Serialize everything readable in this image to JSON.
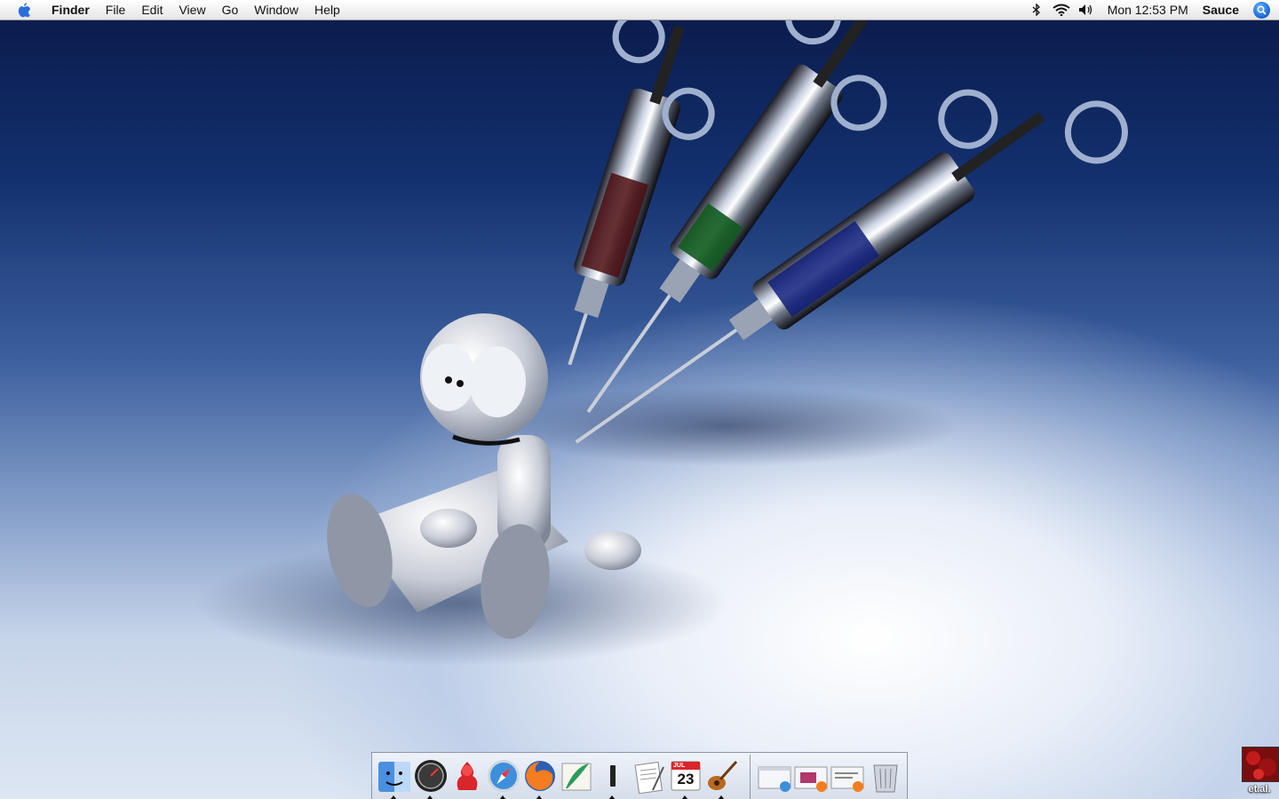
{
  "menubar": {
    "app_name": "Finder",
    "menus": [
      "File",
      "Edit",
      "View",
      "Go",
      "Window",
      "Help"
    ],
    "clock": "Mon 12:53 PM",
    "user": "Sauce",
    "status_icons": [
      "bluetooth-icon",
      "wifi-icon",
      "volume-icon"
    ]
  },
  "dock": {
    "apps": [
      {
        "name": "Finder",
        "icon": "finder-icon",
        "running": true
      },
      {
        "name": "Dashboard",
        "icon": "dashboard-icon",
        "running": true
      },
      {
        "name": "Fire",
        "icon": "fire-chat-icon",
        "running": false
      },
      {
        "name": "Safari",
        "icon": "safari-icon",
        "running": true
      },
      {
        "name": "Firefox",
        "icon": "firefox-icon",
        "running": true
      },
      {
        "name": "Quill",
        "icon": "quill-icon",
        "running": false
      },
      {
        "name": "Terminal",
        "icon": "terminal-icon",
        "running": true
      },
      {
        "name": "TextEdit",
        "icon": "textedit-icon",
        "running": false
      },
      {
        "name": "iCal",
        "icon": "ical-icon",
        "running": true
      },
      {
        "name": "GarageBand",
        "icon": "garageband-icon",
        "running": true
      }
    ],
    "calendar": {
      "month": "JUL",
      "day": "23"
    },
    "minimized": [
      {
        "icon": "minimized-safari-window-icon"
      },
      {
        "icon": "minimized-firefox-window-1-icon"
      },
      {
        "icon": "minimized-firefox-window-2-icon"
      }
    ],
    "trash": {
      "icon": "trash-icon"
    }
  },
  "desktop_item": {
    "label": "et.al."
  },
  "colors": {
    "menubar_bg": "#f2f2f2",
    "wallpaper_dark": "#0a1a4a",
    "wallpaper_light": "#e8eef8"
  }
}
